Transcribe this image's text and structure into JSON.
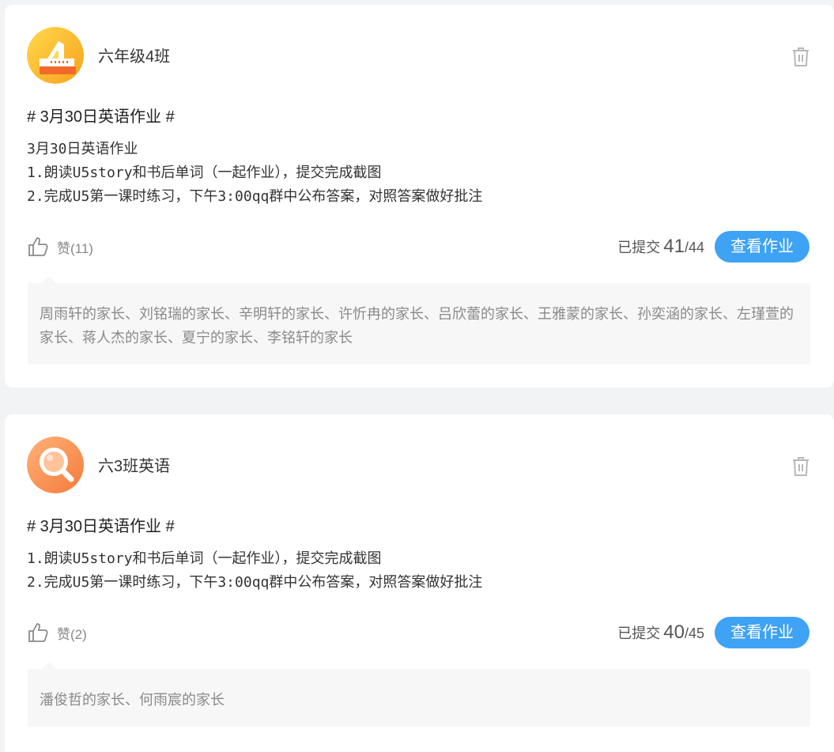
{
  "cards": [
    {
      "class_name": "六年级4班",
      "title": "# 3月30日英语作业 #",
      "lines": [
        "3月30日英语作业",
        "1.朗读U5story和书后单词（一起作业），提交完成截图",
        "2.完成U5第一课时练习，下午3:00qq群中公布答案，对照答案做好批注"
      ],
      "likes_label": "赞(11)",
      "submitted_label": "已提交",
      "submitted_count": "41",
      "submitted_total": "/44",
      "view_button": "查看作业",
      "parents_text": "周雨轩的家长、刘铭瑞的家长、辛明轩的家长、许忻冉的家长、吕欣蕾的家长、王雅蒙的家长、孙奕涵的家长、左瑾萱的家长、蒋人杰的家长、夏宁的家长、李铭轩的家长",
      "avatar_icon": "ruler-logo-icon"
    },
    {
      "class_name": "六3班英语",
      "title": "# 3月30日英语作业 #",
      "lines": [
        "1.朗读U5story和书后单词（一起作业），提交完成截图",
        "2.完成U5第一课时练习，下午3:00qq群中公布答案，对照答案做好批注"
      ],
      "likes_label": "赞(2)",
      "submitted_label": "已提交",
      "submitted_count": "40",
      "submitted_total": "/45",
      "view_button": "查看作业",
      "parents_text": "潘俊哲的家长、何雨宸的家长",
      "avatar_icon": "magnifier-logo-icon"
    }
  ],
  "icons": {
    "delete": "trash-icon",
    "like": "thumbs-up-icon"
  },
  "colors": {
    "accent": "#3ea2f5",
    "background": "#f2f3f5"
  }
}
